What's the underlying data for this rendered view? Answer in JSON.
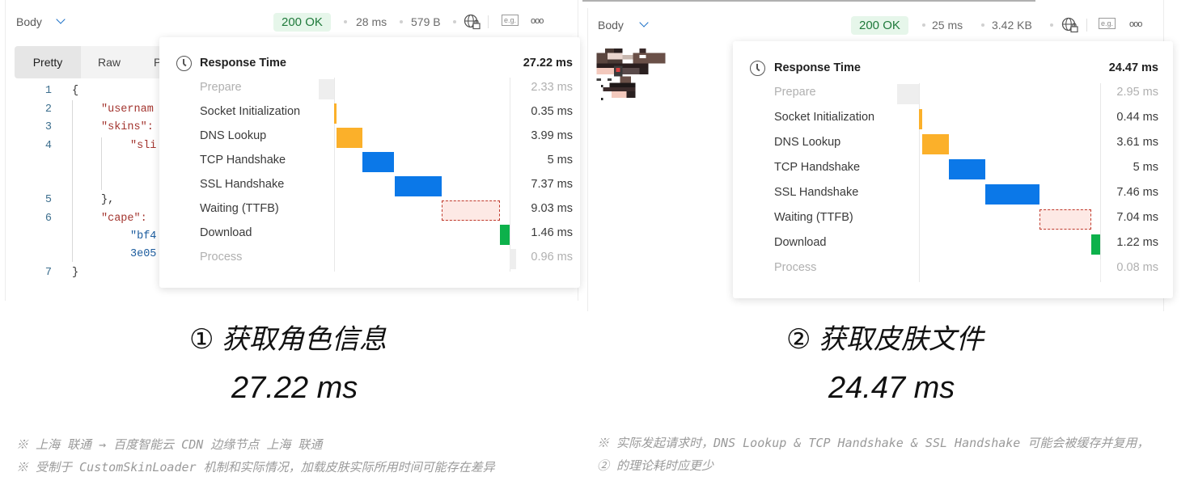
{
  "panels": [
    {
      "body_label": "Body",
      "status": "200 OK",
      "time": "28 ms",
      "size": "579 B",
      "icons": [
        "globe-lock-icon",
        "example-icon",
        "more-icon"
      ],
      "eg_label": "e.g.",
      "more_label": "ooo",
      "tabs": [
        "Pretty",
        "Raw",
        "P"
      ],
      "code_lines": [
        {
          "n": "1",
          "text": "{"
        },
        {
          "n": "2",
          "text": "\"usernam"
        },
        {
          "n": "3",
          "text": "\"skins\":"
        },
        {
          "n": "4",
          "text": "\"sli"
        },
        {
          "n": "5",
          "text": "},"
        },
        {
          "n": "6",
          "text": "\"cape\":"
        },
        {
          "n": "",
          "text": "\"bf4"
        },
        {
          "n": "",
          "text": "3e05"
        },
        {
          "n": "7",
          "text": "}"
        }
      ],
      "popup": {
        "title": "Response Time",
        "total": "27.22 ms",
        "rows": [
          {
            "label": "Prepare",
            "value": "2.33 ms",
            "ms": 2.33,
            "kind": "prepare"
          },
          {
            "label": "Socket Initialization",
            "value": "0.35 ms",
            "ms": 0.35,
            "kind": "socket"
          },
          {
            "label": "DNS Lookup",
            "value": "3.99 ms",
            "ms": 3.99,
            "kind": "dns"
          },
          {
            "label": "TCP Handshake",
            "value": "5 ms",
            "ms": 5,
            "kind": "tcp"
          },
          {
            "label": "SSL Handshake",
            "value": "7.37 ms",
            "ms": 7.37,
            "kind": "ssl"
          },
          {
            "label": "Waiting (TTFB)",
            "value": "9.03 ms",
            "ms": 9.03,
            "kind": "wait"
          },
          {
            "label": "Download",
            "value": "1.46 ms",
            "ms": 1.46,
            "kind": "download"
          },
          {
            "label": "Process",
            "value": "0.96 ms",
            "ms": 0.96,
            "kind": "process"
          }
        ]
      },
      "caption_num": "①",
      "caption": "获取角色信息",
      "caption_ms": "27.22 ms",
      "notes": [
        "※ 上海 联通 → 百度智能云 CDN 边缘节点 上海 联通",
        "※ 受制于 CustomSkinLoader 机制和实际情况，加载皮肤实际所用时间可能存在差异"
      ]
    },
    {
      "body_label": "Body",
      "status": "200 OK",
      "time": "25 ms",
      "size": "3.42 KB",
      "icons": [
        "globe-lock-icon",
        "example-icon",
        "more-icon"
      ],
      "eg_label": "e.g.",
      "more_label": "ooo",
      "popup": {
        "title": "Response Time",
        "total": "24.47 ms",
        "rows": [
          {
            "label": "Prepare",
            "value": "2.95 ms",
            "ms": 2.95,
            "kind": "prepare"
          },
          {
            "label": "Socket Initialization",
            "value": "0.44 ms",
            "ms": 0.44,
            "kind": "socket"
          },
          {
            "label": "DNS Lookup",
            "value": "3.61 ms",
            "ms": 3.61,
            "kind": "dns"
          },
          {
            "label": "TCP Handshake",
            "value": "5 ms",
            "ms": 5,
            "kind": "tcp"
          },
          {
            "label": "SSL Handshake",
            "value": "7.46 ms",
            "ms": 7.46,
            "kind": "ssl"
          },
          {
            "label": "Waiting (TTFB)",
            "value": "7.04 ms",
            "ms": 7.04,
            "kind": "wait"
          },
          {
            "label": "Download",
            "value": "1.22 ms",
            "ms": 1.22,
            "kind": "download"
          },
          {
            "label": "Process",
            "value": "0.08 ms",
            "ms": 0.08,
            "kind": "process"
          }
        ]
      },
      "caption_num": "②",
      "caption": "获取皮肤文件",
      "caption_ms": "24.47 ms",
      "notes": [
        "※ 实际发起请求时，DNS Lookup & TCP Handshake & SSL Handshake 可能会被缓存并复用，",
        "② 的理论耗时应更少"
      ]
    }
  ],
  "colors": {
    "prepare": "#eeeeee",
    "socket": "#fbb02a",
    "dns": "#fbb02a",
    "tcp": "#0b78e8",
    "ssl": "#0b78e8",
    "wait": "#fde9e5",
    "wait_border": "#c0392b",
    "download": "#0db14b",
    "process": "#eeeeee",
    "status_bg": "#e6f6ea",
    "status_text": "#1f7a3b"
  }
}
